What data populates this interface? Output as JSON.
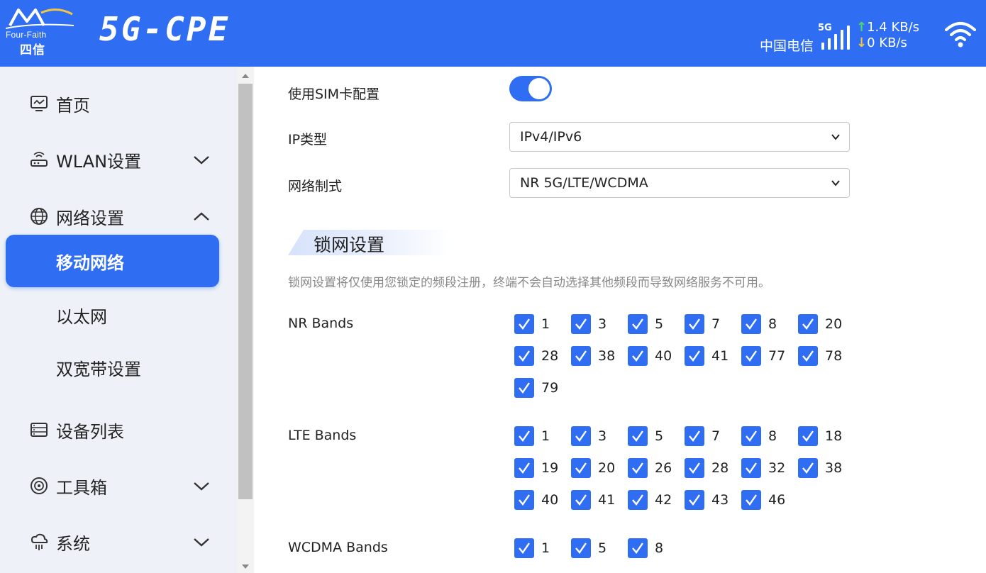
{
  "header": {
    "logo_text": "Four-Faith",
    "logo_cn": "四信",
    "product": "5G-CPE",
    "carrier": "中国电信",
    "network_type": "5G",
    "upload_rate": "1.4 KB/s",
    "download_rate": "0 KB/s",
    "signal_bars": 5,
    "icons": {
      "signal": "signal-bars-icon",
      "wifi": "wifi-icon"
    }
  },
  "sidebar": {
    "items": [
      {
        "label": "首页",
        "icon": "monitor-icon"
      },
      {
        "label": "WLAN设置",
        "icon": "router-icon",
        "expandable": true,
        "expanded": false
      },
      {
        "label": "网络设置",
        "icon": "globe-icon",
        "expandable": true,
        "expanded": true
      },
      {
        "label": "设备列表",
        "icon": "device-list-icon"
      },
      {
        "label": "工具箱",
        "icon": "toolbox-icon",
        "expandable": true,
        "expanded": false
      },
      {
        "label": "系统",
        "icon": "system-icon",
        "expandable": true,
        "expanded": false
      }
    ],
    "network_sub": [
      {
        "label": "移动网络",
        "active": true
      },
      {
        "label": "以太网",
        "active": false
      },
      {
        "label": "双宽带设置",
        "active": false
      }
    ]
  },
  "form": {
    "sim_config_label": "使用SIM卡配置",
    "sim_config_on": true,
    "ip_type_label": "IP类型",
    "ip_type_value": "IPv4/IPv6",
    "net_mode_label": "网络制式",
    "net_mode_value": "NR 5G/LTE/WCDMA"
  },
  "lock": {
    "title": "锁网设置",
    "desc": "锁网设置将仅使用您锁定的频段注册，终端不会自动选择其他频段而导致网络服务不可用。",
    "nr_label": "NR Bands",
    "nr_bands": [
      "1",
      "3",
      "5",
      "7",
      "8",
      "20",
      "28",
      "38",
      "40",
      "41",
      "77",
      "78",
      "79"
    ],
    "lte_label": "LTE Bands",
    "lte_bands": [
      "1",
      "3",
      "5",
      "7",
      "8",
      "18",
      "19",
      "20",
      "26",
      "28",
      "32",
      "38",
      "40",
      "41",
      "42",
      "43",
      "46"
    ],
    "wcdma_label": "WCDMA Bands",
    "wcdma_bands": [
      "1",
      "5",
      "8"
    ]
  },
  "colors": {
    "accent": "#2f6ef2",
    "sidebar_bg": "#eef2f8",
    "desc": "#888888"
  }
}
